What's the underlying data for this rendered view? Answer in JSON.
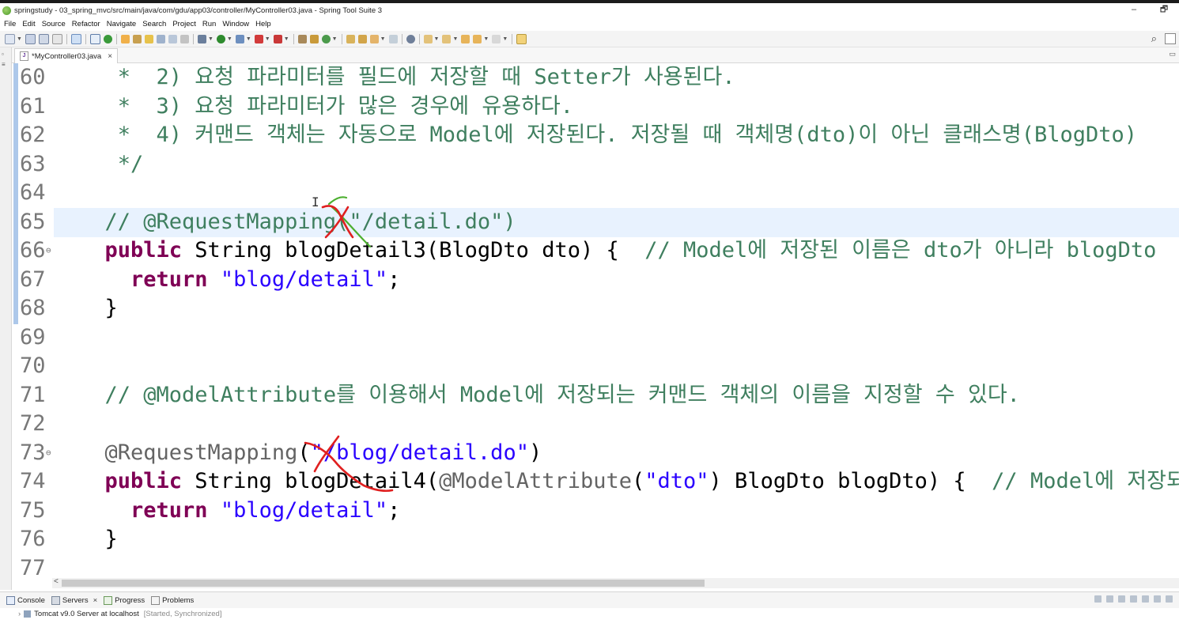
{
  "window": {
    "title": "springstudy - 03_spring_mvc/src/main/java/com/gdu/app03/controller/MyController03.java - Spring Tool Suite 3",
    "minimize": "‒",
    "restore": "🗗"
  },
  "menu": [
    "File",
    "Edit",
    "Source",
    "Refactor",
    "Navigate",
    "Search",
    "Project",
    "Run",
    "Window",
    "Help"
  ],
  "editor_tab": {
    "label": "*MyController03.java",
    "close": "×"
  },
  "code_lines": [
    {
      "num": "60",
      "fold": "",
      "segments": [
        {
          "t": "cm",
          "s": "   *  2) 요청 파라미터를 필드에 저장할 때 Setter가 사용된다."
        }
      ]
    },
    {
      "num": "61",
      "fold": "",
      "segments": [
        {
          "t": "cm",
          "s": "   *  3) 요청 파라미터가 많은 경우에 유용하다."
        }
      ]
    },
    {
      "num": "62",
      "fold": "",
      "segments": [
        {
          "t": "cm",
          "s": "   *  4) 커맨드 객체는 자동으로 Model에 저장된다. 저장될 때 객체명(dto)이 아닌 클래스명(BlogDto)"
        }
      ]
    },
    {
      "num": "63",
      "fold": "",
      "segments": [
        {
          "t": "cm",
          "s": "   */"
        }
      ]
    },
    {
      "num": "64",
      "fold": "",
      "segments": []
    },
    {
      "num": "65",
      "fold": "",
      "segments": [
        {
          "t": "cm",
          "s": "  // @RequestMapping(\"/detail.do\")"
        }
      ]
    },
    {
      "num": "66",
      "fold": "⊖",
      "segments": [
        {
          "t": "kw",
          "s": "  public"
        },
        {
          "t": "pl",
          "s": " String blogDetail3(BlogDto dto) {  "
        },
        {
          "t": "cm",
          "s": "// Model에 저장된 이름은 dto가 아니라 blogDto"
        }
      ]
    },
    {
      "num": "67",
      "fold": "",
      "segments": [
        {
          "t": "kw",
          "s": "    return"
        },
        {
          "t": "pl",
          "s": " "
        },
        {
          "t": "st",
          "s": "\"blog/detail\""
        },
        {
          "t": "pl",
          "s": ";"
        }
      ]
    },
    {
      "num": "68",
      "fold": "",
      "segments": [
        {
          "t": "pl",
          "s": "  }"
        }
      ]
    },
    {
      "num": "69",
      "fold": "",
      "segments": []
    },
    {
      "num": "70",
      "fold": "",
      "segments": []
    },
    {
      "num": "71",
      "fold": "",
      "segments": [
        {
          "t": "cm",
          "s": "  // @ModelAttribute를 이용해서 Model에 저장되는 커맨드 객체의 이름을 지정할 수 있다."
        }
      ]
    },
    {
      "num": "72",
      "fold": "",
      "segments": []
    },
    {
      "num": "73",
      "fold": "⊖",
      "segments": [
        {
          "t": "an",
          "s": "  @RequestMapping"
        },
        {
          "t": "pl",
          "s": "("
        },
        {
          "t": "st",
          "s": "\"/blog/detail.do\""
        },
        {
          "t": "pl",
          "s": ")"
        }
      ]
    },
    {
      "num": "74",
      "fold": "",
      "segments": [
        {
          "t": "kw",
          "s": "  public"
        },
        {
          "t": "pl",
          "s": " String blogDetail4("
        },
        {
          "t": "an",
          "s": "@ModelAttribute"
        },
        {
          "t": "pl",
          "s": "("
        },
        {
          "t": "st",
          "s": "\"dto\""
        },
        {
          "t": "pl",
          "s": ") BlogDto blogDto) {  "
        },
        {
          "t": "cm",
          "s": "// Model에 저장되는"
        }
      ]
    },
    {
      "num": "75",
      "fold": "",
      "segments": [
        {
          "t": "kw",
          "s": "    return"
        },
        {
          "t": "pl",
          "s": " "
        },
        {
          "t": "st",
          "s": "\"blog/detail\""
        },
        {
          "t": "pl",
          "s": ";"
        }
      ]
    },
    {
      "num": "76",
      "fold": "",
      "segments": [
        {
          "t": "pl",
          "s": "  }"
        }
      ]
    },
    {
      "num": "77",
      "fold": "",
      "segments": []
    }
  ],
  "bottom_tabs": [
    {
      "label": "Console",
      "closable": false
    },
    {
      "label": "Servers",
      "closable": true
    },
    {
      "label": "Progress",
      "closable": false
    },
    {
      "label": "Problems",
      "closable": false
    }
  ],
  "server": {
    "name": "Tomcat v9.0 Server at localhost",
    "state": "[Started, Synchronized]"
  },
  "scroll_left_arrow": "<",
  "close_glyph": "×",
  "colors": {
    "comment": "#3f7f5f",
    "keyword": "#7f0055",
    "string": "#2a00ff",
    "annotation": "#646464",
    "current_line": "#e8f2fe",
    "ink_red": "#e02020",
    "ink_green": "#4caf2f"
  }
}
